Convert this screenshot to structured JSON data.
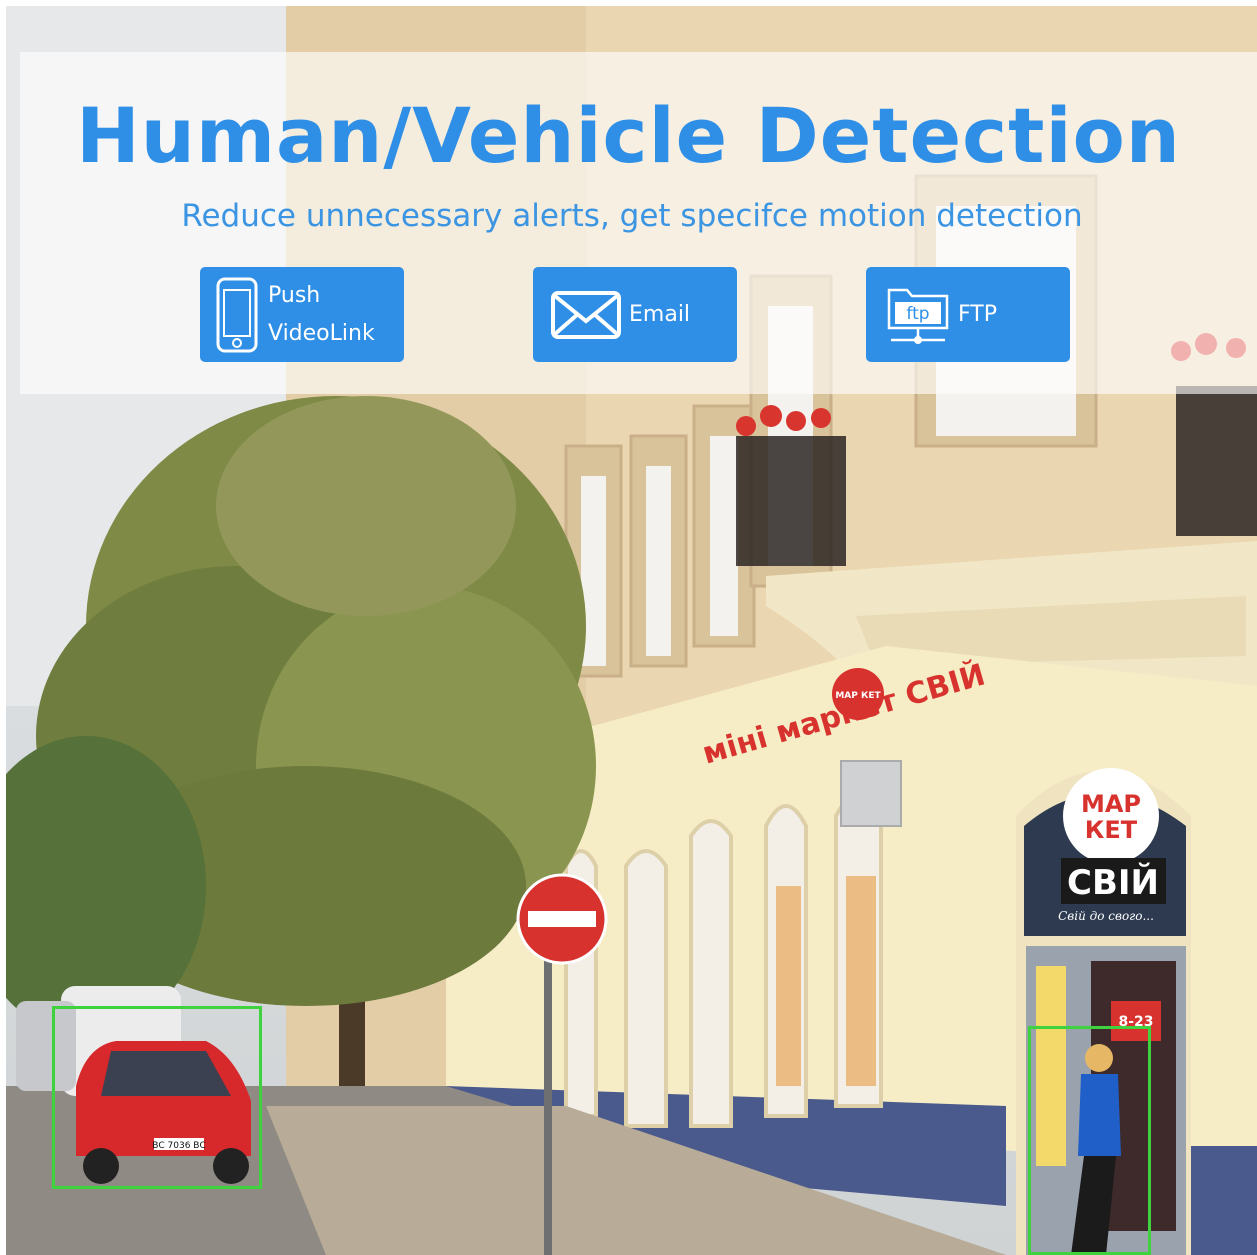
{
  "banner": {
    "title": "Human/Vehicle Detection",
    "subtitle": "Reduce unnecessary alerts, get specifce motion detection",
    "accent_color": "#2f8fe6",
    "detection_box_color": "#3ed23e"
  },
  "features": [
    {
      "icon": "smartphone-icon",
      "label": "Push\nVideoLink"
    },
    {
      "icon": "envelope-icon",
      "label": "Email"
    },
    {
      "icon": "ftp-folder-icon",
      "label": "FTP",
      "icon_text": "ftp"
    }
  ],
  "scene": {
    "shop_sign": "міні маркет СВІЙ",
    "shop_badge_top": "МАР",
    "shop_badge_bottom": "КЕТ",
    "shop_name": "СВІЙ",
    "shop_tagline": "Свій до свого...",
    "sign_badge_small": "МАР КЕТ",
    "license_plate": "ВС 7036 ВС",
    "poster_number": "8-23"
  }
}
